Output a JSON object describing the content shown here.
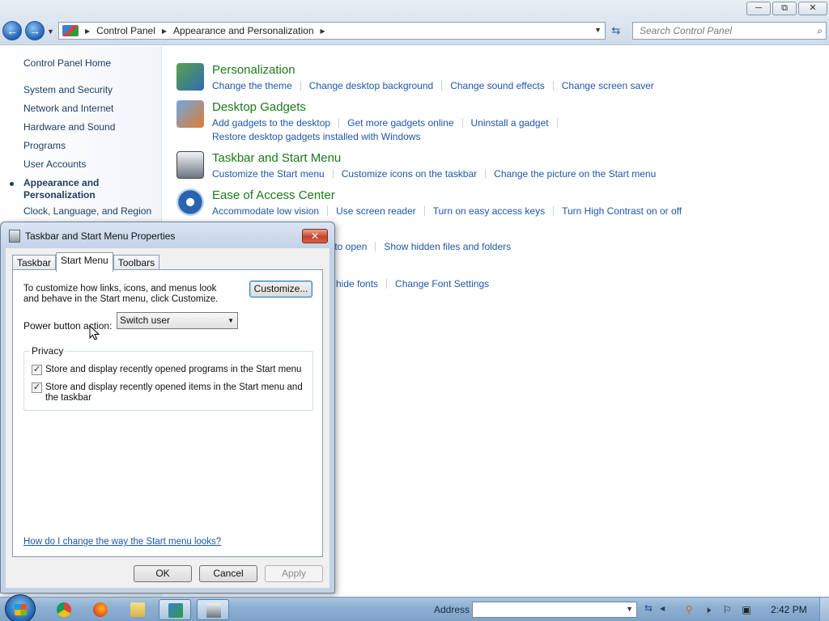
{
  "window": {
    "caption_buttons": [
      "▭",
      "⧉",
      "✕"
    ]
  },
  "navigation": {
    "back_glyph": "←",
    "forward_glyph": "→",
    "breadcrumb": [
      "Control Panel",
      "Appearance and Personalization"
    ],
    "search_placeholder": "Search Control Panel"
  },
  "left_pane": {
    "items": [
      "Control Panel Home",
      "System and Security",
      "Network and Internet",
      "Hardware and Sound",
      "Programs",
      "User Accounts",
      "Appearance and Personalization",
      "Clock, Language, and Region"
    ],
    "current_item_line1": "Appearance and",
    "current_item_line2": "Personalization"
  },
  "categories": {
    "personalization": {
      "title": "Personalization",
      "links": [
        "Change the theme",
        "Change desktop background",
        "Change sound effects",
        "Change screen saver"
      ]
    },
    "desktop_gadgets": {
      "title": "Desktop Gadgets",
      "links": [
        "Add gadgets to the desktop",
        "Get more gadgets online",
        "Uninstall a gadget"
      ],
      "links_row2": [
        "Restore desktop gadgets installed with Windows"
      ]
    },
    "taskbar_start": {
      "title": "Taskbar and Start Menu",
      "links": [
        "Customize the Start menu",
        "Customize icons on the taskbar",
        "Change the picture on the Start menu"
      ]
    },
    "ease_of_access": {
      "title": "Ease of Access Center",
      "links": [
        "Accommodate low vision",
        "Use screen reader",
        "Turn on easy access keys",
        "Turn High Contrast on or off"
      ]
    },
    "folder_options_partial": {
      "links": [
        "ck to open",
        "Show hidden files and folders"
      ]
    },
    "fonts_partial": {
      "links": [
        "hide fonts",
        "Change Font Settings"
      ]
    }
  },
  "dialog": {
    "title": "Taskbar and Start Menu Properties",
    "close_glyph": "✕",
    "tabs": [
      "Taskbar",
      "Start Menu",
      "Toolbars"
    ],
    "active_tab": "Start Menu",
    "description": "To customize how links, icons, and menus look and behave in the Start menu, click Customize.",
    "customize_label": "Customize...",
    "power_button_label": "Power button action:",
    "power_button_value": "Switch user",
    "privacy_label": "Privacy",
    "checkbox1_label": "Store and display recently opened programs in the Start menu",
    "checkbox1_checked": true,
    "checkbox2_label": "Store and display recently opened items in the Start menu and the taskbar",
    "checkbox2_checked": true,
    "help_link": "How do I change the way the Start menu looks?",
    "ok_label": "OK",
    "cancel_label": "Cancel",
    "apply_label": "Apply"
  },
  "taskbar": {
    "address_label": "Address",
    "clock": "2:42 PM",
    "apps": [
      "chrome-icon",
      "firefox-icon",
      "explorer-icon",
      "control-panel-icon",
      "taskbar-properties-icon"
    ]
  },
  "colors": {
    "link": "#1e56a8",
    "category_title": "#1a7a1a",
    "left_pane_text": "#1e3a5f",
    "dialog_frame": "#c3d3e7",
    "taskbar": "#8eb0d2"
  }
}
